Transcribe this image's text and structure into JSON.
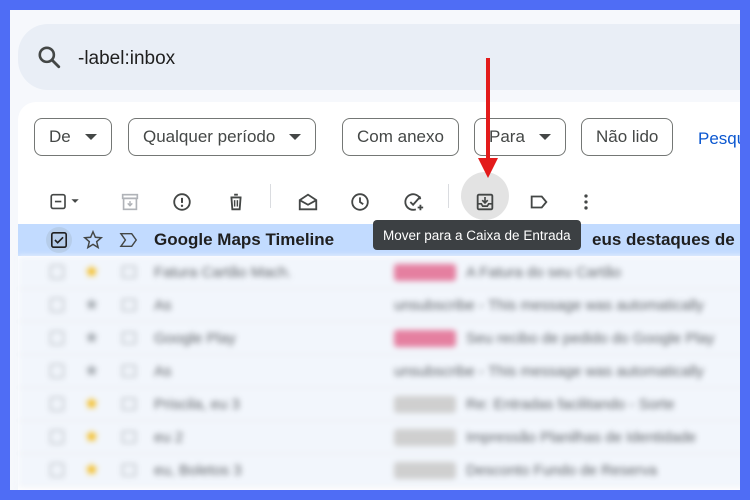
{
  "search": {
    "query": "-label:inbox"
  },
  "filters": {
    "chips": [
      {
        "label": "De",
        "dropdown": true
      },
      {
        "label": "Qualquer período",
        "dropdown": true
      },
      {
        "label": "Com anexo",
        "dropdown": false
      },
      {
        "label": "Para",
        "dropdown": true
      },
      {
        "label": "Não lido",
        "dropdown": false
      }
    ],
    "link": "Pesqui"
  },
  "toolbar": {
    "icons": [
      "select-all-checkbox-icon",
      "archive-icon",
      "report-spam-icon",
      "delete-icon",
      "mark-unread-icon",
      "snooze-icon",
      "add-task-icon",
      "move-to-inbox-icon",
      "label-icon",
      "more-icon"
    ],
    "tooltip": "Mover para a Caixa de Entrada"
  },
  "selected_email": {
    "sender": "Google Maps Timeline",
    "subject_visible": "eus destaques de m"
  },
  "blurred_rows": [
    {
      "sender": "Fatura Cartão Mach.",
      "starred": true,
      "tag": "pink",
      "snippet": "A Fatura do seu Cartão"
    },
    {
      "sender": "As",
      "starred": false,
      "tag": "",
      "snippet": "unsubscribe - This message was automatically"
    },
    {
      "sender": "Google Play",
      "starred": false,
      "tag": "pink",
      "snippet": "Seu recibo de pedido do Google Play"
    },
    {
      "sender": "As",
      "starred": false,
      "tag": "",
      "snippet": "unsubscribe - This message was automatically"
    },
    {
      "sender": "Priscila, eu 3",
      "starred": true,
      "tag": "grey",
      "snippet": "Re: Entradas facilitando - Sorte"
    },
    {
      "sender": "eu 2",
      "starred": true,
      "tag": "grey",
      "snippet": "Impressão Planilhas de Identidade"
    },
    {
      "sender": "eu, Boletos 3",
      "starred": true,
      "tag": "grey",
      "snippet": "Desconto Fundo de Reserva"
    }
  ],
  "colors": {
    "accent": "#0b57d0",
    "arrow": "#e31b1b",
    "selected_row": "#c2dbff",
    "border": "#4f6df5"
  }
}
